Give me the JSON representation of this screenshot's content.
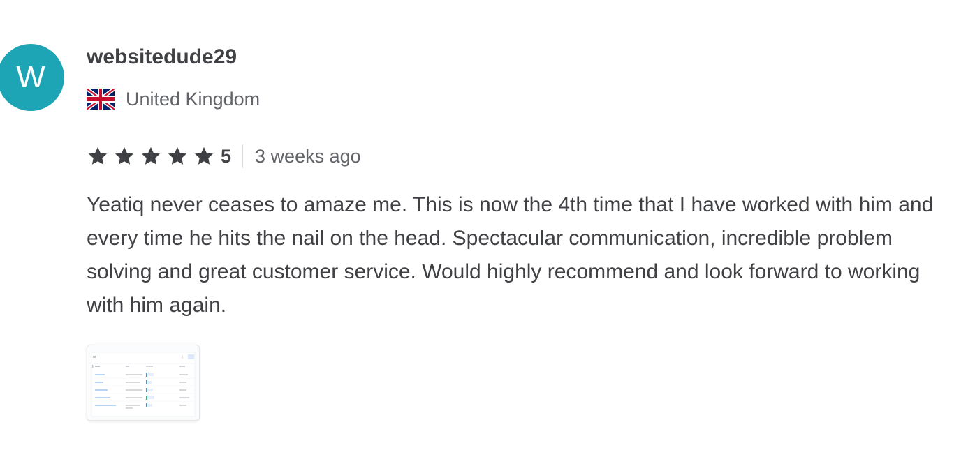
{
  "reviewer": {
    "avatar_initial": "W",
    "avatar_color": "#1ea5b5",
    "username": "websitedude29",
    "country": "United Kingdom",
    "flag_icon": "uk-flag-icon"
  },
  "rating": {
    "stars": 5,
    "value": "5",
    "star_icon": "star-icon",
    "star_color": "#404145"
  },
  "time_ago": "3 weeks ago",
  "review_text": "Yeatiq never ceases to amaze me. This is now the 4th time that I have worked with him and every time he hits the nail on the head. Spectacular communication, incredible problem solving and great customer service. Would highly recommend and look forward to working with him again.",
  "attachment": {
    "type": "image-thumbnail"
  }
}
